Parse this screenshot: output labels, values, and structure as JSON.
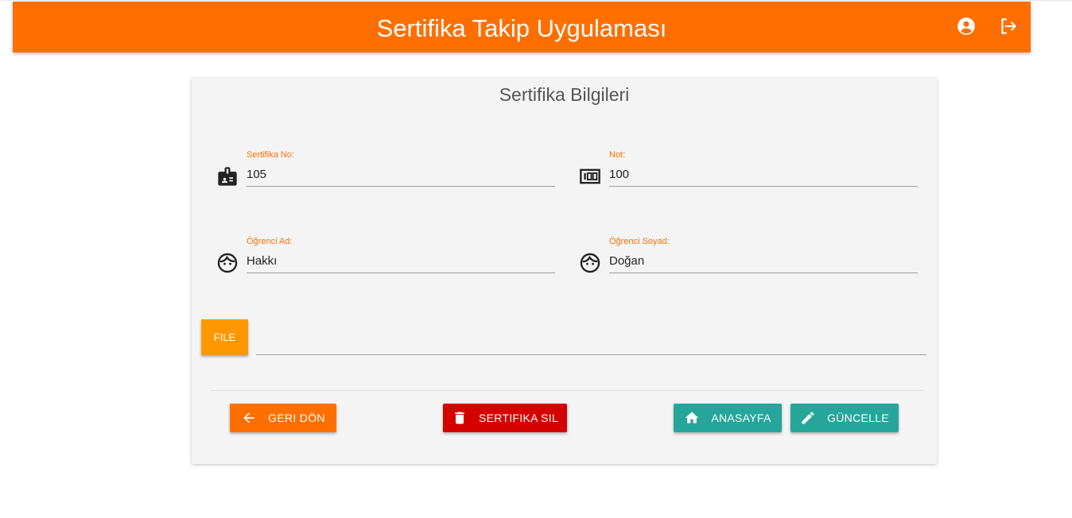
{
  "header": {
    "title": "Sertifika Takip Uygulaması",
    "account_icon": "account-circle-icon",
    "logout_icon": "logout-icon"
  },
  "card": {
    "title": "Sertifika Bilgileri",
    "fields": {
      "certificate_no": {
        "label": "Sertifika No:",
        "value": "105",
        "icon": "badge-icon"
      },
      "grade": {
        "label": "Not:",
        "value": "100",
        "icon": "score-100-icon"
      },
      "student_name": {
        "label": "Öğrenci Ad:",
        "value": "Hakkı",
        "icon": "face-icon"
      },
      "student_surname": {
        "label": "Öğrenci Soyad:",
        "value": "Doğan",
        "icon": "face-icon"
      }
    },
    "file": {
      "button_label": "FILE",
      "path_value": ""
    }
  },
  "actions": {
    "back_label": "GERI DÖN",
    "delete_label": "SERTIFIKA SIL",
    "home_label": "ANASAYFA",
    "update_label": "GÜNCELLE"
  },
  "colors": {
    "primary": "#ff6f00",
    "file": "#ff9800",
    "danger": "#d50000",
    "teal": "#26a69a",
    "label": "#ff6f00"
  }
}
